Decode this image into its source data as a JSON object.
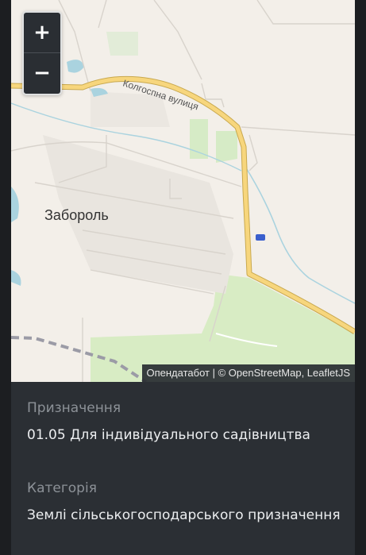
{
  "map": {
    "place_label": "Забороль",
    "street_label": "Колгоспна вулиця",
    "zoom_in": "+",
    "zoom_out": "−",
    "attribution": {
      "provider": "Опендатабот",
      "separator": " | ",
      "copyright": "© OpenStreetMap",
      "separator2": ", ",
      "library": "LeafletJS"
    },
    "colors": {
      "background": "#f3efe9",
      "road": "#f7d67d",
      "water": "#aad3df",
      "park": "#cdebb0",
      "railway": "#9b9ba6"
    }
  },
  "details": [
    {
      "label": "Призначення",
      "value": "01.05 Для індивідуального садівництва"
    },
    {
      "label": "Категорія",
      "value": "Землі сільськогосподарського призначення"
    }
  ]
}
